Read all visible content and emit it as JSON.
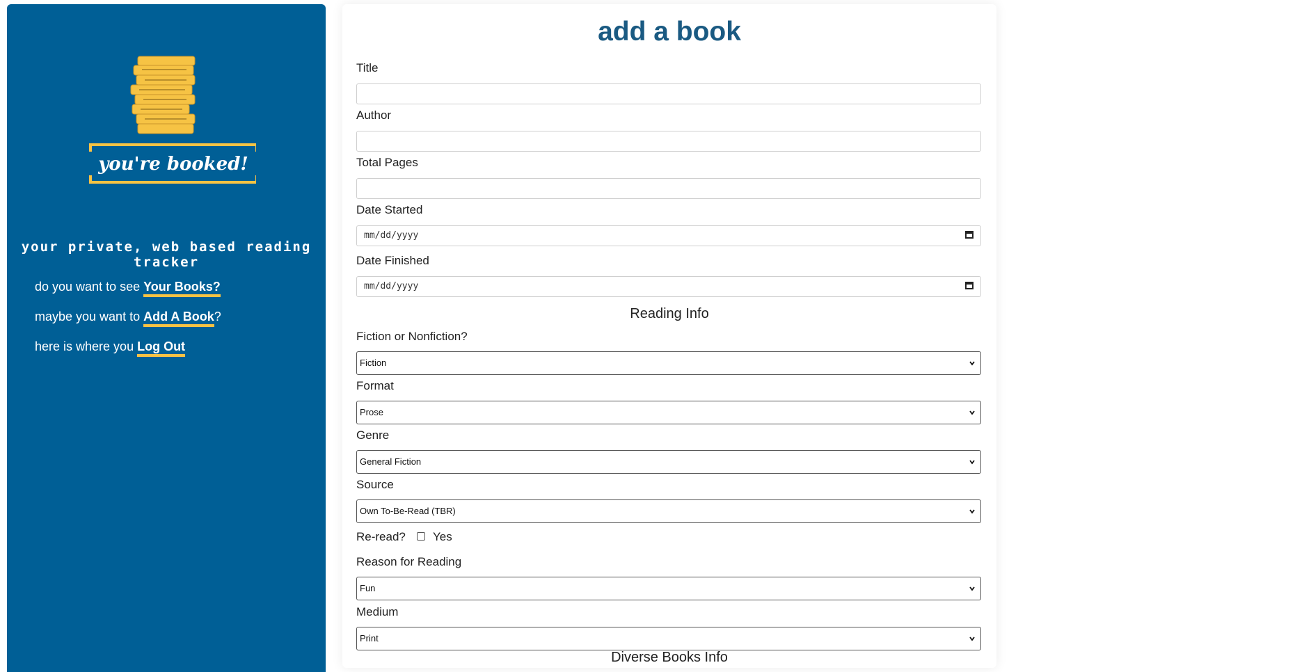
{
  "sidebar": {
    "logo_text": "you're booked!",
    "tagline": "your private, web based reading tracker",
    "nav": [
      {
        "prefix": "do you want to see ",
        "link": "Your Books?",
        "suffix": ""
      },
      {
        "prefix": "maybe you want to ",
        "link": "Add A Book",
        "suffix": "?"
      },
      {
        "prefix": "here is where you ",
        "link": "Log Out",
        "suffix": ""
      }
    ]
  },
  "form": {
    "title": "add a book",
    "title_label": "Title",
    "author_label": "Author",
    "pages_label": "Total Pages",
    "date_started_label": "Date Started",
    "date_started_placeholder": "mm/dd/yyyy",
    "date_finished_label": "Date Finished",
    "date_finished_placeholder": "mm/dd/yyyy",
    "reading_info_heading": "Reading Info",
    "fiction_label": "Fiction or Nonfiction?",
    "fiction_value": "Fiction",
    "format_label": "Format",
    "format_value": "Prose",
    "genre_label": "Genre",
    "genre_value": "General Fiction",
    "source_label": "Source",
    "source_value": "Own To-Be-Read (TBR)",
    "reread_label": "Re-read?",
    "reread_option": "Yes",
    "reason_label": "Reason for Reading",
    "reason_value": "Fun",
    "medium_label": "Medium",
    "medium_value": "Print",
    "diverse_heading": "Diverse Books Info"
  },
  "colors": {
    "sidebar_bg": "#005f96",
    "accent_yellow": "#f6c344",
    "title_blue": "#1a5a82"
  }
}
